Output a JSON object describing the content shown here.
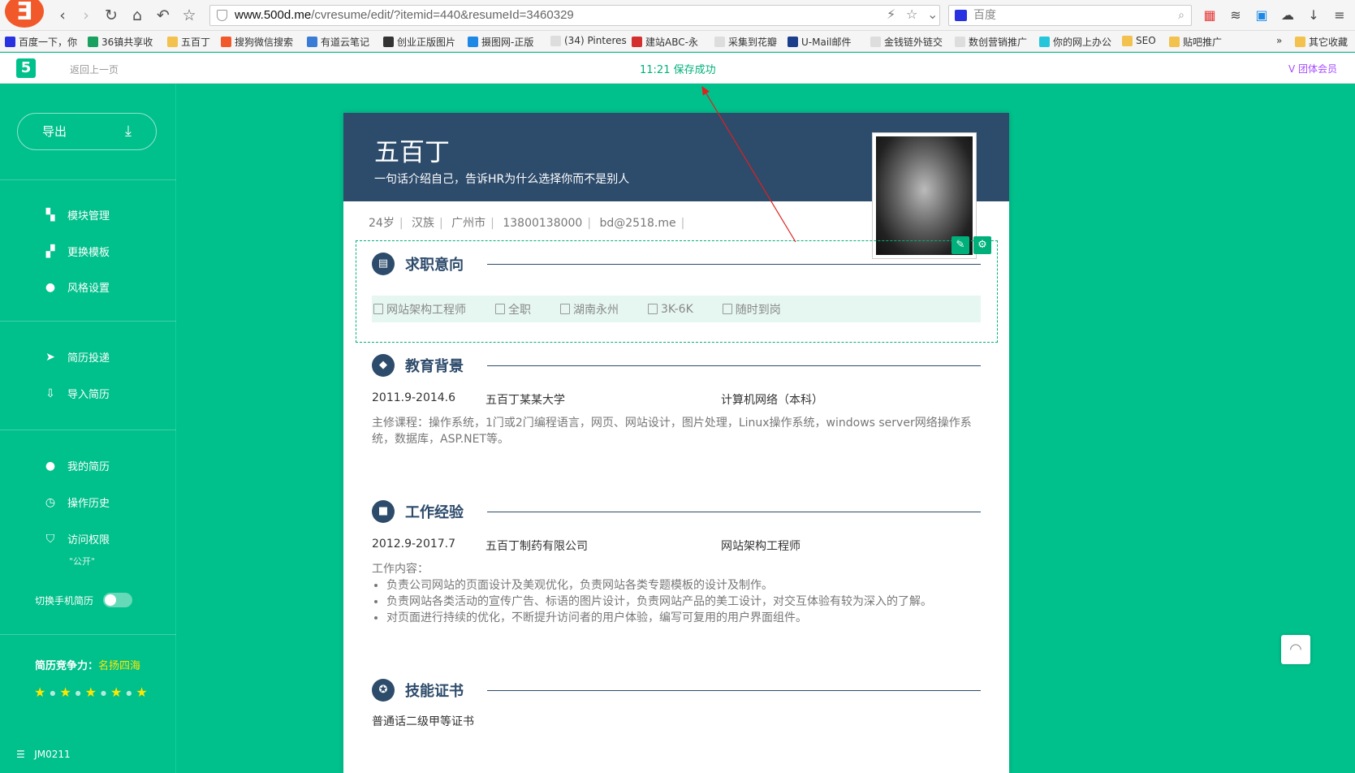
{
  "browser": {
    "url_domain": "www.500d.me",
    "url_path": "/cvresume/edit/?itemid=440&resumeId=3460329",
    "search_placeholder": "百度"
  },
  "bookmarks": [
    {
      "label": "百度一下，你",
      "color": "#2932e1"
    },
    {
      "label": "36镇共享收",
      "color": "#19a15f"
    },
    {
      "label": "五百丁",
      "color": "#f2c14e"
    },
    {
      "label": "搜狗微信搜索",
      "color": "#f1592a"
    },
    {
      "label": "有道云笔记",
      "color": "#3a7bd5"
    },
    {
      "label": "创业正版图片",
      "color": "#333333"
    },
    {
      "label": "摄图网-正版",
      "color": "#1e88e5"
    },
    {
      "label": "(34) Pinteres",
      "color": "#dddddd"
    },
    {
      "label": "建站ABC-永",
      "color": "#d32f2f"
    },
    {
      "label": "采集到花瓣",
      "color": "#dddddd"
    },
    {
      "label": "U-Mail邮件",
      "color": "#1a3e8c"
    },
    {
      "label": "金钱链外链交",
      "color": "#dddddd"
    },
    {
      "label": "数创营销推广",
      "color": "#dddddd"
    },
    {
      "label": "你的网上办公",
      "color": "#26c6da"
    },
    {
      "label": "SEO",
      "color": "#f2c14e"
    },
    {
      "label": "贴吧推广",
      "color": "#f2c14e"
    },
    {
      "label": "其它收藏",
      "color": "#f2c14e"
    }
  ],
  "bookmarks_more": "»",
  "header": {
    "back": "返回上一页",
    "save_status": "11:21 保存成功",
    "vip": "团体会员"
  },
  "sidebar": {
    "export": "导出",
    "items": [
      {
        "label": "模块管理",
        "icon": "modules-icon"
      },
      {
        "label": "更换模板",
        "icon": "template-icon"
      },
      {
        "label": "风格设置",
        "icon": "palette-icon"
      },
      {
        "label": "简历投递",
        "icon": "send-icon"
      },
      {
        "label": "导入简历",
        "icon": "import-icon"
      },
      {
        "label": "我的简历",
        "icon": "user-icon"
      },
      {
        "label": "操作历史",
        "icon": "clock-icon"
      },
      {
        "label": "访问权限",
        "icon": "shield-icon"
      }
    ],
    "access_value": "\"公开\"",
    "toggle_label": "切换手机简历",
    "compete_label": "简历竞争力：",
    "compete_value": "名扬四海",
    "stars": 5,
    "template_code": "JM0211"
  },
  "resume": {
    "name": "五百丁",
    "tagline": "一句话介绍自己，告诉HR为什么选择你而不是别人",
    "info": [
      "24岁",
      "汉族",
      "广州市",
      "13800138000",
      "bd@2518.me"
    ],
    "sections": {
      "intent": {
        "title": "求职意向",
        "items": [
          "网站架构工程师",
          "全职",
          "湖南永州",
          "3K-6K",
          "随时到岗"
        ]
      },
      "education": {
        "title": "教育背景",
        "date": "2011.9-2014.6",
        "school": "五百丁某某大学",
        "major": "计算机网络（本科）",
        "desc": "主修课程：操作系统，1门或2门编程语言，网页、网站设计，图片处理，Linux操作系统，windows server网络操作系统，数据库，ASP.NET等。"
      },
      "work": {
        "title": "工作经验",
        "date": "2012.9-2017.7",
        "company": "五百丁制药有限公司",
        "role": "网站架构工程师",
        "intro": "工作内容：",
        "bullets": [
          "负责公司网站的页面设计及美观优化，负责网站各类专题模板的设计及制作。",
          "负责网站各类活动的宣传广告、标语的图片设计，负责网站产品的美工设计，对交互体验有较为深入的了解。",
          "对页面进行持续的优化，不断提升访问者的用户体验，编写可复用的用户界面组件。"
        ]
      },
      "skills": {
        "title": "技能证书",
        "first": "普通话二级甲等证书"
      }
    }
  }
}
